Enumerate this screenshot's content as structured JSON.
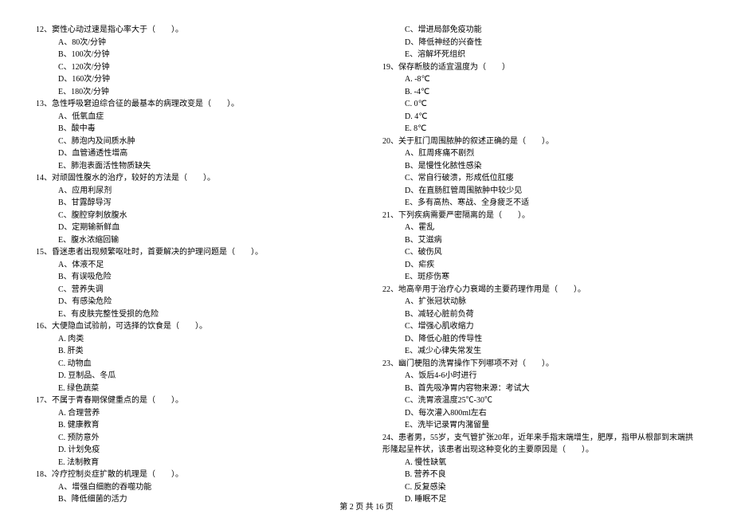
{
  "left": {
    "q12": {
      "text": "12、窦性心动过速是指心率大于（　　）。",
      "options": [
        "A、80次/分钟",
        "B、100次/分钟",
        "C、120次/分钟",
        "D、160次/分钟",
        "E、180次/分钟"
      ]
    },
    "q13": {
      "text": "13、急性呼吸窘迫综合征的最基本的病理改变是（　　）。",
      "options": [
        "A、低氧血症",
        "B、酸中毒",
        "C、肺泡内及间质水肿",
        "D、血管通透性增高",
        "E、肺泡表面活性物质缺失"
      ]
    },
    "q14": {
      "text": "14、对顽固性腹水的治疗，较好的方法是（　　）。",
      "options": [
        "A、应用利尿剂",
        "B、甘露醇导泻",
        "C、腹腔穿刺放腹水",
        "D、定期输新鲜血",
        "E、腹水浓缩回输"
      ]
    },
    "q15": {
      "text": "15、昏迷患者出现频繁呕吐时，首要解决的护理问题是（　　）。",
      "options": [
        "A、体液不足",
        "B、有误吸危险",
        "C、营养失调",
        "D、有感染危险",
        "E、有皮肤完整性受损的危险"
      ]
    },
    "q16": {
      "text": "16、大便隐血试验前，可选择的饮食是（　　）。",
      "options": [
        "A. 肉类",
        "B. 肝类",
        "C. 动物血",
        "D. 豆制品、冬瓜",
        "E. 绿色蔬菜"
      ]
    },
    "q17": {
      "text": "17、不属于青春期保健重点的是（　　）。",
      "options": [
        "A. 合理营养",
        "B. 健康教育",
        "C. 预防意外",
        "D. 计划免疫",
        "E. 法制教育"
      ]
    },
    "q18": {
      "text": "18、冷疗控制炎症扩散的机理是（　　）。",
      "options": [
        "A、增强白细胞的吞噬功能",
        "B、降低细菌的活力"
      ]
    }
  },
  "right": {
    "q18cont": {
      "options": [
        "C、增进局部免疫功能",
        "D、降低神经的兴奋性",
        "E、溶解坏死组织"
      ]
    },
    "q19": {
      "text": "19、保存断肢的适宜温度为（　　）",
      "options": [
        "A. -8℃",
        "B. -4℃",
        "C. 0℃",
        "D. 4℃",
        "E. 8℃"
      ]
    },
    "q20": {
      "text": "20、关于肛门周围脓肿的叙述正确的是（　　）。",
      "options": [
        "A、肛周疼痛不剧烈",
        "B、是慢性化脓性感染",
        "C、常自行破溃，形成低位肛瘘",
        "D、在直肠肛管周围脓肿中较少见",
        "E、多有高热、寒战、全身疲乏不适"
      ]
    },
    "q21": {
      "text": "21、下列疾病需要严密隔离的是（　　）。",
      "options": [
        "A、霍乱",
        "B、艾滋病",
        "C、破伤风",
        "D、疟疾",
        "E、斑疹伤寒"
      ]
    },
    "q22": {
      "text": "22、地高辛用于治疗心力衰竭的主要药理作用是（　　）。",
      "options": [
        "A、扩张冠状动脉",
        "B、减轻心脏前负荷",
        "C、增强心肌收缩力",
        "D、降低心脏的传导性",
        "E、减少心律失常发生"
      ]
    },
    "q23": {
      "text": "23、幽门梗阻的洗胃操作下列哪项不对（　　）。",
      "options": [
        "A、饭后4-6小时进行",
        "B、首先吸净胃内容物来源：考试大",
        "C、洗胃液温度25℃-30℃",
        "D、每次灌入800ml左右",
        "E、洗毕记录胃内潴留量"
      ]
    },
    "q24": {
      "text": "24、患者男，55岁，支气管扩张20年，近年来手指末端增生，肥厚，指甲从根部到末端拱形隆起呈杵状，该患者出现这种变化的主要原因是（　　）。",
      "options": [
        "A. 慢性缺氧",
        "B. 营养不良",
        "C. 反复感染",
        "D. 睡眠不足"
      ]
    }
  },
  "footer": "第 2 页 共 16 页"
}
